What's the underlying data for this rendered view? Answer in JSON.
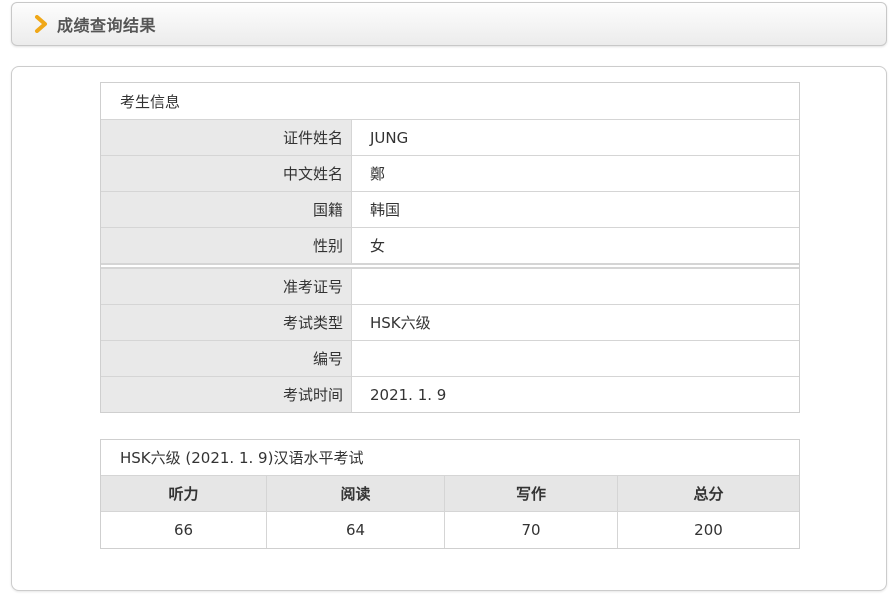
{
  "header": {
    "title": "成绩查询结果"
  },
  "info": {
    "section_title": "考生信息",
    "rows": [
      {
        "label": "证件姓名",
        "value": "JUNG"
      },
      {
        "label": "中文姓名",
        "value": "鄭"
      },
      {
        "label": "国籍",
        "value": "韩国"
      },
      {
        "label": "性别",
        "value": "女"
      },
      {
        "label": "准考证号",
        "value": ""
      },
      {
        "label": "考试类型",
        "value": "HSK六级"
      },
      {
        "label": "编号",
        "value": ""
      },
      {
        "label": "考试时间",
        "value": "2021. 1. 9"
      }
    ]
  },
  "scores": {
    "title": "HSK六级 (2021. 1. 9)汉语水平考试",
    "headers": [
      "听力",
      "阅读",
      "写作",
      "总分"
    ],
    "values": [
      "66",
      "64",
      "70",
      "200"
    ]
  },
  "colors": {
    "accent": "#f0a818"
  }
}
